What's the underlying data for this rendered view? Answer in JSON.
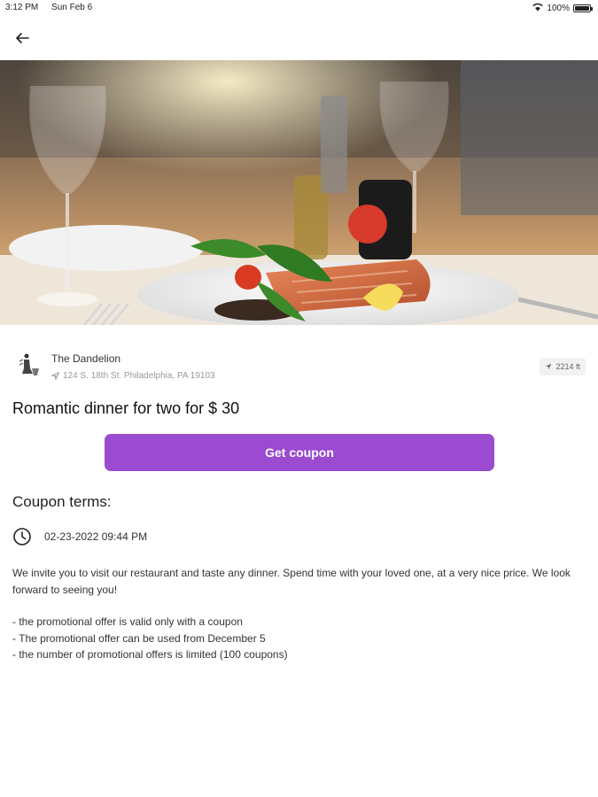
{
  "status_bar": {
    "time": "3:12 PM",
    "date": "Sun Feb 6",
    "battery_percent": "100%",
    "battery_level": 1.0
  },
  "nav": {
    "back_icon": "arrow-left-icon"
  },
  "venue": {
    "name": "The Dandelion",
    "address": "124 S. 18th St. Philadelphia, PA 19103",
    "distance": "2214 ft"
  },
  "offer": {
    "title": "Romantic dinner for two for $ 30",
    "button_label": "Get coupon"
  },
  "terms": {
    "heading": "Coupon terms:",
    "datetime": "02-23-2022 09:44 PM",
    "description": "We invite you to visit our restaurant and taste any dinner. Spend time with your loved one, at a very nice price. We look forward to seeing you!",
    "conditions": [
      "- the promotional offer is valid only with a coupon",
      "- The promotional offer can be used from December 5",
      "- the number of promotional offers is limited (100 coupons)"
    ]
  },
  "colors": {
    "accent": "#9b4bcf",
    "text_primary": "#111111",
    "text_muted": "#9a9a9a"
  }
}
